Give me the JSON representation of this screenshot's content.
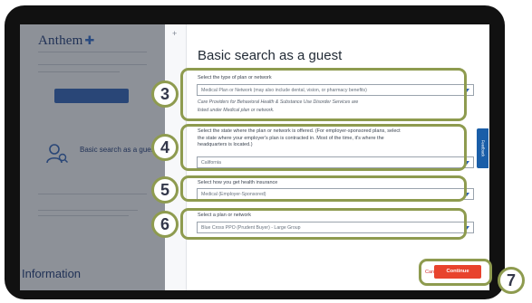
{
  "background_page": {
    "logo": "Anthem",
    "guest_link": "Basic search as a guest",
    "section_heading": "Information"
  },
  "modal": {
    "add_icon": "plus-icon",
    "title": "Basic search as a guest",
    "plan_type": {
      "label": "Select the type of plan or network",
      "value": "Medical Plan or Network (may also include dental, vision, or pharmacy benefits)",
      "note_line1": "Care Providers for Behavioral Health & Substance Use Disorder Services are",
      "note_line2": "listed under Medical plan or network."
    },
    "state": {
      "label_line1": "Select the state where the plan or network is offered. (For employer-sponsored plans, select",
      "label_line2": "the state where your employer's plan is contracted in. Most of the time, it's where the",
      "label_line3": "headquarters is located.)",
      "value": "California"
    },
    "insurance": {
      "label": "Select how you get health insurance",
      "value": "Medical (Employer-Sponsored)"
    },
    "network": {
      "label": "Select a plan or network",
      "value": "Blue Cross PPO (Prudent Buyer) - Large Group"
    },
    "cancel_label": "Cancel",
    "continue_label": "Continue"
  },
  "feedback_tab": "Feedback",
  "annotations": {
    "step3": "3",
    "step4": "4",
    "step5": "5",
    "step6": "6",
    "step7": "7",
    "highlight_color": "#8e9b4f"
  },
  "colors": {
    "accent_blue": "#2b5fb4",
    "continue_red": "#e8432d",
    "bezel": "#111111"
  }
}
